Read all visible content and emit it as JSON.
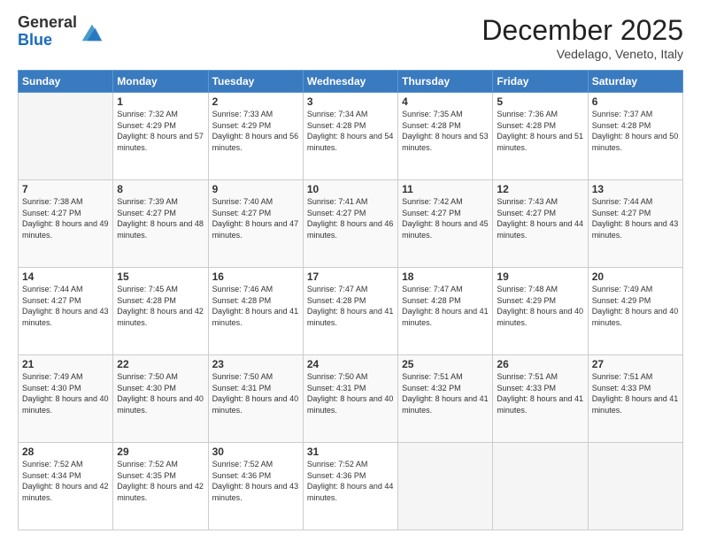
{
  "logo": {
    "line1": "General",
    "line2": "Blue"
  },
  "title": "December 2025",
  "location": "Vedelago, Veneto, Italy",
  "weekdays": [
    "Sunday",
    "Monday",
    "Tuesday",
    "Wednesday",
    "Thursday",
    "Friday",
    "Saturday"
  ],
  "weeks": [
    [
      {
        "day": "",
        "sunrise": "",
        "sunset": "",
        "daylight": ""
      },
      {
        "day": "1",
        "sunrise": "7:32 AM",
        "sunset": "4:29 PM",
        "daylight": "8 hours and 57 minutes."
      },
      {
        "day": "2",
        "sunrise": "7:33 AM",
        "sunset": "4:29 PM",
        "daylight": "8 hours and 56 minutes."
      },
      {
        "day": "3",
        "sunrise": "7:34 AM",
        "sunset": "4:28 PM",
        "daylight": "8 hours and 54 minutes."
      },
      {
        "day": "4",
        "sunrise": "7:35 AM",
        "sunset": "4:28 PM",
        "daylight": "8 hours and 53 minutes."
      },
      {
        "day": "5",
        "sunrise": "7:36 AM",
        "sunset": "4:28 PM",
        "daylight": "8 hours and 51 minutes."
      },
      {
        "day": "6",
        "sunrise": "7:37 AM",
        "sunset": "4:28 PM",
        "daylight": "8 hours and 50 minutes."
      }
    ],
    [
      {
        "day": "7",
        "sunrise": "7:38 AM",
        "sunset": "4:27 PM",
        "daylight": "8 hours and 49 minutes."
      },
      {
        "day": "8",
        "sunrise": "7:39 AM",
        "sunset": "4:27 PM",
        "daylight": "8 hours and 48 minutes."
      },
      {
        "day": "9",
        "sunrise": "7:40 AM",
        "sunset": "4:27 PM",
        "daylight": "8 hours and 47 minutes."
      },
      {
        "day": "10",
        "sunrise": "7:41 AM",
        "sunset": "4:27 PM",
        "daylight": "8 hours and 46 minutes."
      },
      {
        "day": "11",
        "sunrise": "7:42 AM",
        "sunset": "4:27 PM",
        "daylight": "8 hours and 45 minutes."
      },
      {
        "day": "12",
        "sunrise": "7:43 AM",
        "sunset": "4:27 PM",
        "daylight": "8 hours and 44 minutes."
      },
      {
        "day": "13",
        "sunrise": "7:44 AM",
        "sunset": "4:27 PM",
        "daylight": "8 hours and 43 minutes."
      }
    ],
    [
      {
        "day": "14",
        "sunrise": "7:44 AM",
        "sunset": "4:27 PM",
        "daylight": "8 hours and 43 minutes."
      },
      {
        "day": "15",
        "sunrise": "7:45 AM",
        "sunset": "4:28 PM",
        "daylight": "8 hours and 42 minutes."
      },
      {
        "day": "16",
        "sunrise": "7:46 AM",
        "sunset": "4:28 PM",
        "daylight": "8 hours and 41 minutes."
      },
      {
        "day": "17",
        "sunrise": "7:47 AM",
        "sunset": "4:28 PM",
        "daylight": "8 hours and 41 minutes."
      },
      {
        "day": "18",
        "sunrise": "7:47 AM",
        "sunset": "4:28 PM",
        "daylight": "8 hours and 41 minutes."
      },
      {
        "day": "19",
        "sunrise": "7:48 AM",
        "sunset": "4:29 PM",
        "daylight": "8 hours and 40 minutes."
      },
      {
        "day": "20",
        "sunrise": "7:49 AM",
        "sunset": "4:29 PM",
        "daylight": "8 hours and 40 minutes."
      }
    ],
    [
      {
        "day": "21",
        "sunrise": "7:49 AM",
        "sunset": "4:30 PM",
        "daylight": "8 hours and 40 minutes."
      },
      {
        "day": "22",
        "sunrise": "7:50 AM",
        "sunset": "4:30 PM",
        "daylight": "8 hours and 40 minutes."
      },
      {
        "day": "23",
        "sunrise": "7:50 AM",
        "sunset": "4:31 PM",
        "daylight": "8 hours and 40 minutes."
      },
      {
        "day": "24",
        "sunrise": "7:50 AM",
        "sunset": "4:31 PM",
        "daylight": "8 hours and 40 minutes."
      },
      {
        "day": "25",
        "sunrise": "7:51 AM",
        "sunset": "4:32 PM",
        "daylight": "8 hours and 41 minutes."
      },
      {
        "day": "26",
        "sunrise": "7:51 AM",
        "sunset": "4:33 PM",
        "daylight": "8 hours and 41 minutes."
      },
      {
        "day": "27",
        "sunrise": "7:51 AM",
        "sunset": "4:33 PM",
        "daylight": "8 hours and 41 minutes."
      }
    ],
    [
      {
        "day": "28",
        "sunrise": "7:52 AM",
        "sunset": "4:34 PM",
        "daylight": "8 hours and 42 minutes."
      },
      {
        "day": "29",
        "sunrise": "7:52 AM",
        "sunset": "4:35 PM",
        "daylight": "8 hours and 42 minutes."
      },
      {
        "day": "30",
        "sunrise": "7:52 AM",
        "sunset": "4:36 PM",
        "daylight": "8 hours and 43 minutes."
      },
      {
        "day": "31",
        "sunrise": "7:52 AM",
        "sunset": "4:36 PM",
        "daylight": "8 hours and 44 minutes."
      },
      {
        "day": "",
        "sunrise": "",
        "sunset": "",
        "daylight": ""
      },
      {
        "day": "",
        "sunrise": "",
        "sunset": "",
        "daylight": ""
      },
      {
        "day": "",
        "sunrise": "",
        "sunset": "",
        "daylight": ""
      }
    ]
  ],
  "labels": {
    "sunrise": "Sunrise:",
    "sunset": "Sunset:",
    "daylight": "Daylight:"
  },
  "colors": {
    "header_bg": "#3a7abf",
    "accent": "#1a6bbf"
  }
}
